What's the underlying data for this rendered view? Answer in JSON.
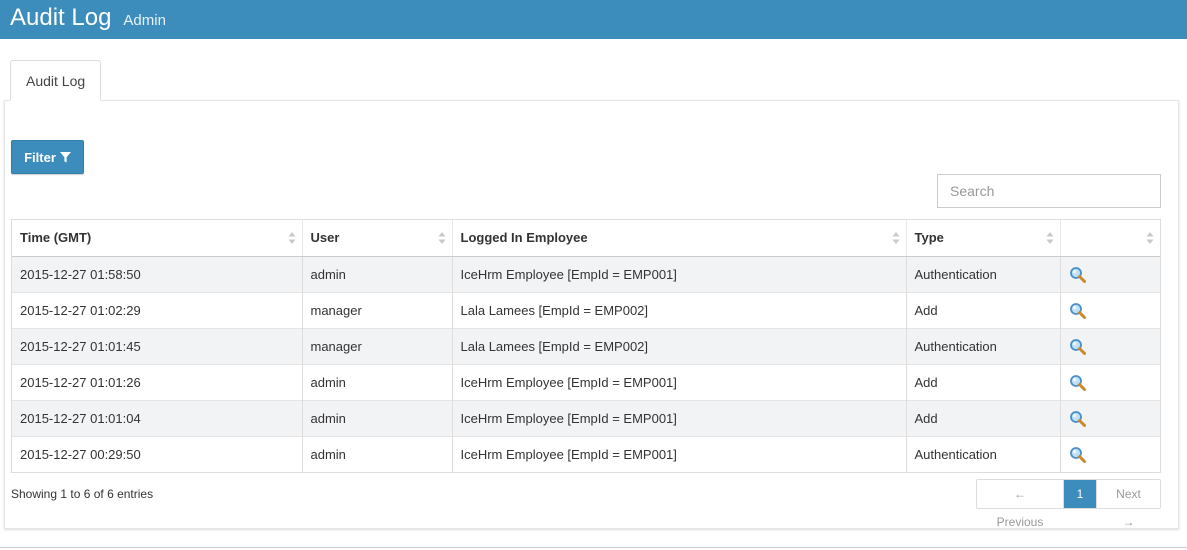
{
  "header": {
    "title": "Audit Log",
    "subtitle": "Admin"
  },
  "tabs": [
    {
      "label": "Audit Log"
    }
  ],
  "toolbar": {
    "filter_label": "Filter"
  },
  "search": {
    "placeholder": "Search"
  },
  "table": {
    "columns": [
      "Time (GMT)",
      "User",
      "Logged In Employee",
      "Type",
      ""
    ],
    "rows": [
      {
        "time": "2015-12-27 01:58:50",
        "user": "admin",
        "employee": "IceHrm Employee [EmpId = EMP001]",
        "type": "Authentication"
      },
      {
        "time": "2015-12-27 01:02:29",
        "user": "manager",
        "employee": "Lala Lamees [EmpId = EMP002]",
        "type": "Add"
      },
      {
        "time": "2015-12-27 01:01:45",
        "user": "manager",
        "employee": "Lala Lamees [EmpId = EMP002]",
        "type": "Authentication"
      },
      {
        "time": "2015-12-27 01:01:26",
        "user": "admin",
        "employee": "IceHrm Employee [EmpId = EMP001]",
        "type": "Add"
      },
      {
        "time": "2015-12-27 01:01:04",
        "user": "admin",
        "employee": "IceHrm Employee [EmpId = EMP001]",
        "type": "Add"
      },
      {
        "time": "2015-12-27 00:29:50",
        "user": "admin",
        "employee": "IceHrm Employee [EmpId = EMP001]",
        "type": "Authentication"
      }
    ]
  },
  "footer": {
    "info": "Showing 1 to 6 of 6 entries",
    "pagination": {
      "previous": "← Previous",
      "current": "1",
      "next": "Next →"
    }
  },
  "colors": {
    "brand": "#3c8dbc",
    "row_alt": "#f2f3f5"
  }
}
